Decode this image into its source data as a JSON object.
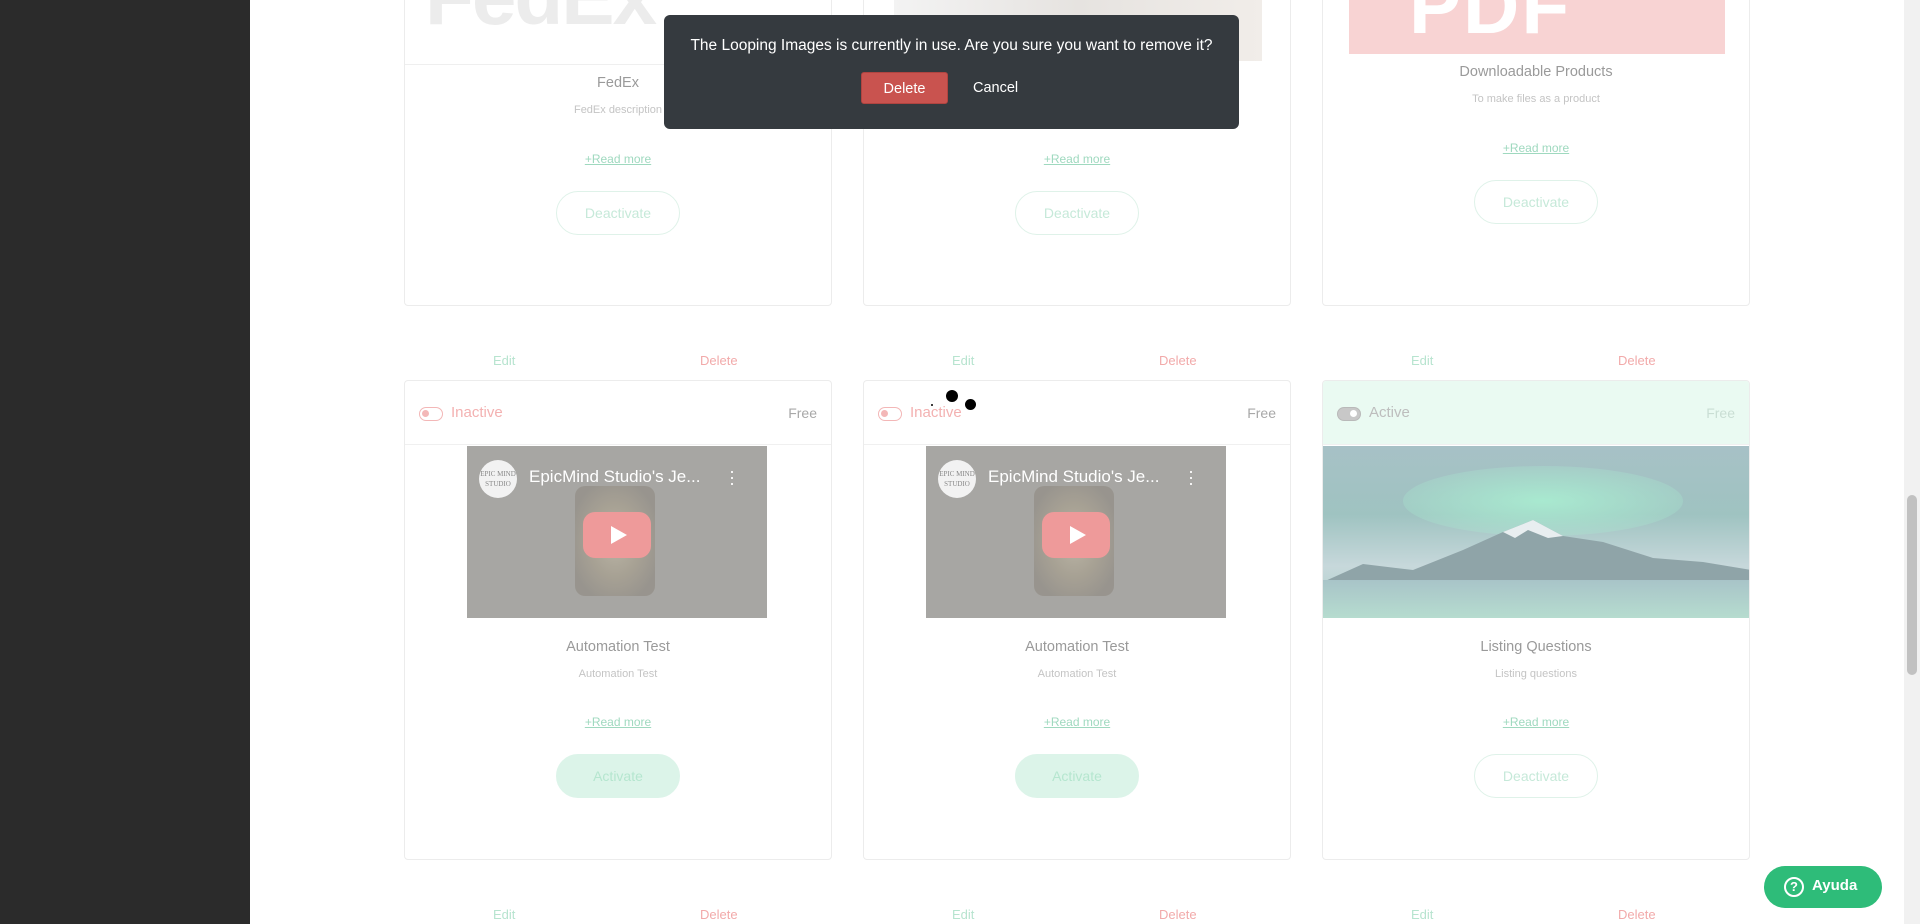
{
  "modal": {
    "message": "The Looping Images is currently in use. Are you sure you want to remove it?",
    "delete_label": "Delete",
    "cancel_label": "Cancel"
  },
  "top_cards": [
    {
      "title": "FedEx",
      "description": "FedEx description",
      "read_more": "+Read more",
      "button": "Deactivate"
    },
    {
      "title": "",
      "description": "",
      "read_more": "+Read more",
      "button": "Deactivate"
    },
    {
      "title": "Downloadable Products",
      "description": "To make files as a product",
      "read_more": "+Read more",
      "button": "Deactivate"
    }
  ],
  "row_actions": {
    "edit": "Edit",
    "delete": "Delete"
  },
  "cards": [
    {
      "status": "Inactive",
      "price": "Free",
      "video_channel": "EPIC MIND STUDIO",
      "video_title": "EpicMind Studio's Je...",
      "title": "Automation Test",
      "description": "Automation Test",
      "read_more": "+Read more",
      "button": "Activate"
    },
    {
      "status": "Inactive",
      "price": "Free",
      "video_channel": "EPIC MIND STUDIO",
      "video_title": "EpicMind Studio's Je...",
      "title": "Automation Test",
      "description": "Automation Test",
      "read_more": "+Read more",
      "button": "Activate"
    },
    {
      "status": "Active",
      "price": "Free",
      "title": "Listing Questions",
      "description": "Listing questions",
      "read_more": "+Read more",
      "button": "Deactivate"
    }
  ],
  "top_thumbs": {
    "fedex_text": "FedEx",
    "pdf_text": "PDF"
  },
  "help": {
    "label": "Ayuda",
    "icon": "question-circle-icon"
  },
  "colors": {
    "accent": "#2ebc79",
    "danger": "#c9534f",
    "modal_bg": "#353a3f",
    "sidebar": "#2b2b2b"
  }
}
